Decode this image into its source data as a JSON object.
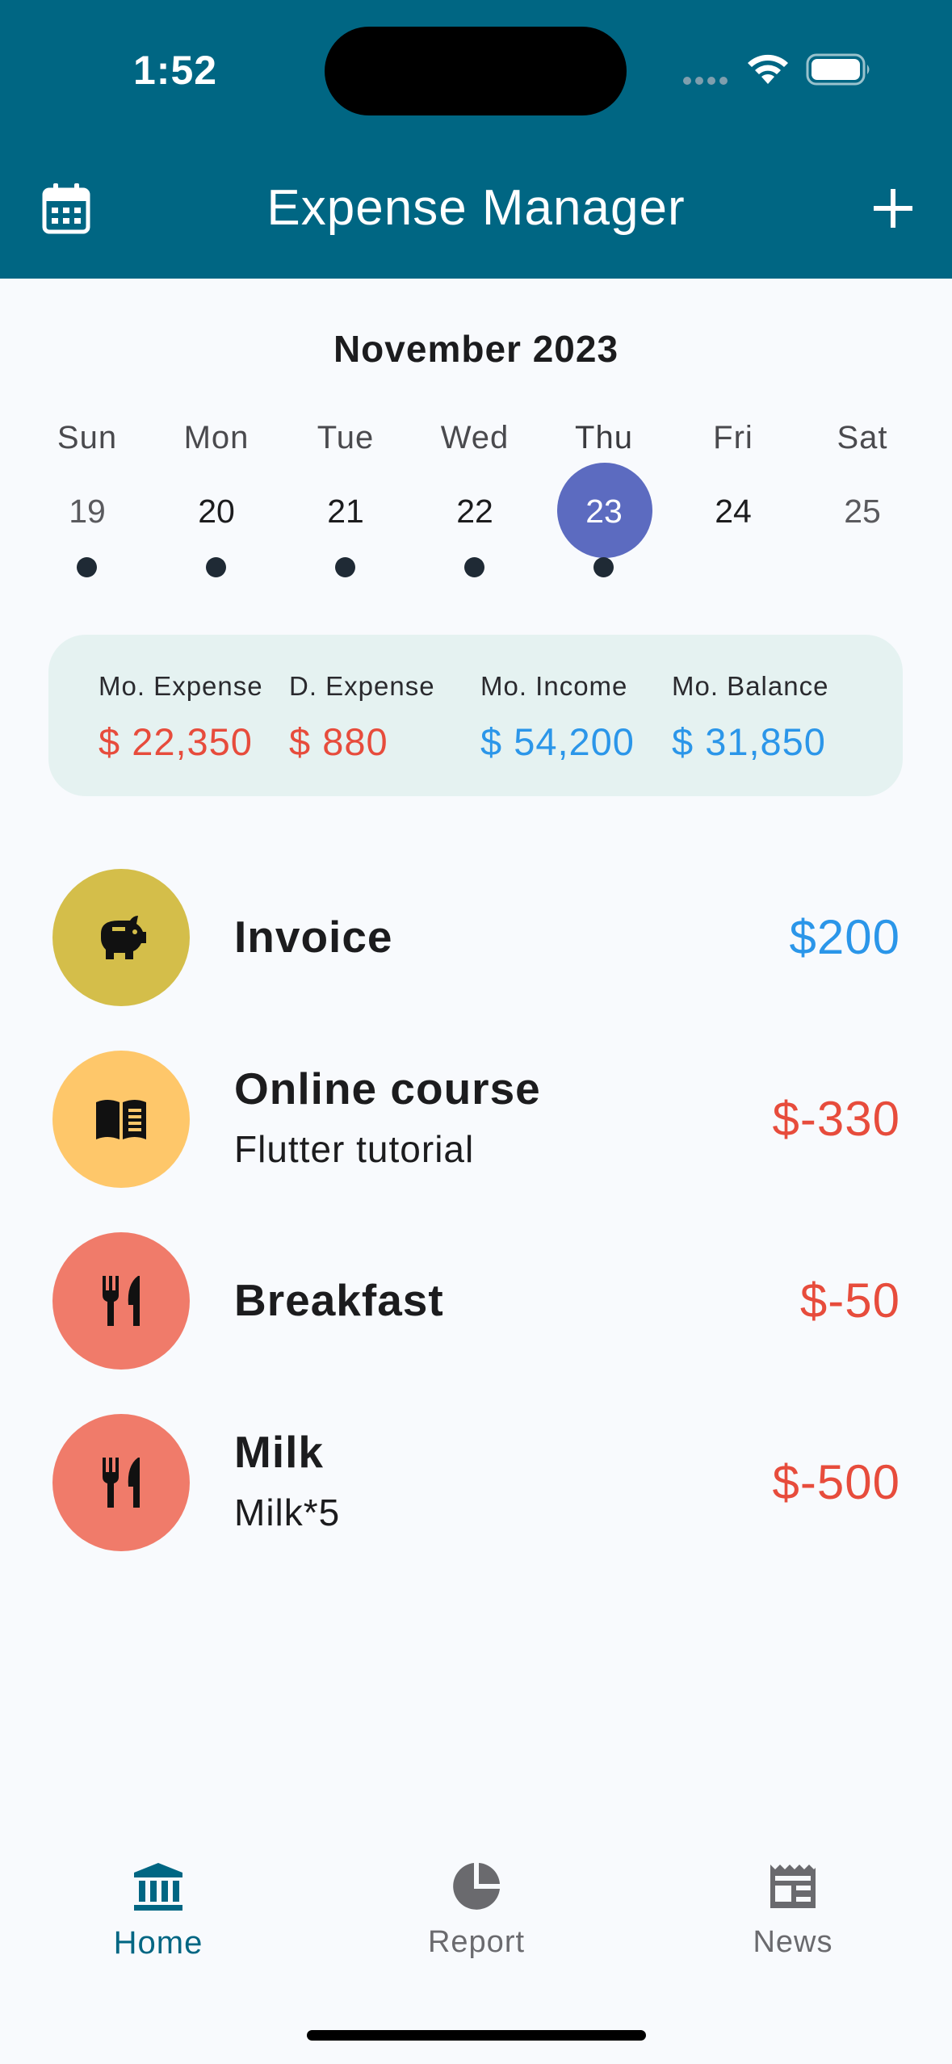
{
  "status_bar": {
    "time": "1:52"
  },
  "header": {
    "title": "Expense Manager",
    "calendar_icon": "calendar-icon",
    "add_icon": "plus-icon"
  },
  "calendar": {
    "month": "November 2023",
    "days": [
      {
        "name": "Sun",
        "num": "19",
        "dot": true
      },
      {
        "name": "Mon",
        "num": "20",
        "dot": true
      },
      {
        "name": "Tue",
        "num": "21",
        "dot": true
      },
      {
        "name": "Wed",
        "num": "22",
        "dot": true
      },
      {
        "name": "Thu",
        "num": "23",
        "dot": true,
        "selected": true
      },
      {
        "name": "Fri",
        "num": "24",
        "dot": false
      },
      {
        "name": "Sat",
        "num": "25",
        "dot": false
      }
    ],
    "selected_color": "#5C6BC0"
  },
  "summary": {
    "mo_expense": {
      "label": "Mo. Expense",
      "value": "$ 22,350"
    },
    "d_expense": {
      "label": "D. Expense",
      "value": "$ 880"
    },
    "mo_income": {
      "label": "Mo. Income",
      "value": "$ 54,200"
    },
    "mo_balance": {
      "label": "Mo. Balance",
      "value": "$ 31,850"
    }
  },
  "transactions": [
    {
      "title": "Invoice",
      "subtitle": "",
      "amount": "$200",
      "icon": "piggy-bank-icon",
      "icon_bg": "#D4BE4A",
      "amount_color": "#2B96E9"
    },
    {
      "title": "Online course",
      "subtitle": "Flutter tutorial",
      "amount": "$-330",
      "icon": "book-icon",
      "icon_bg": "#FEC76A",
      "amount_color": "#E74C3C"
    },
    {
      "title": "Breakfast",
      "subtitle": "",
      "amount": "$-50",
      "icon": "fork-knife-icon",
      "icon_bg": "#F07B6A",
      "amount_color": "#E74C3C"
    },
    {
      "title": "Milk",
      "subtitle": "Milk*5",
      "amount": "$-500",
      "icon": "fork-knife-icon",
      "icon_bg": "#F07B6A",
      "amount_color": "#E74C3C"
    }
  ],
  "bottom_nav": {
    "items": [
      {
        "label": "Home",
        "icon": "bank-icon",
        "active": true
      },
      {
        "label": "Report",
        "icon": "pie-chart-icon",
        "active": false
      },
      {
        "label": "News",
        "icon": "newspaper-icon",
        "active": false
      }
    ]
  },
  "colors": {
    "header_bg": "#006683",
    "summary_bg": "#E5F2F1",
    "expense": "#E74C3C",
    "income": "#2B96E9"
  }
}
